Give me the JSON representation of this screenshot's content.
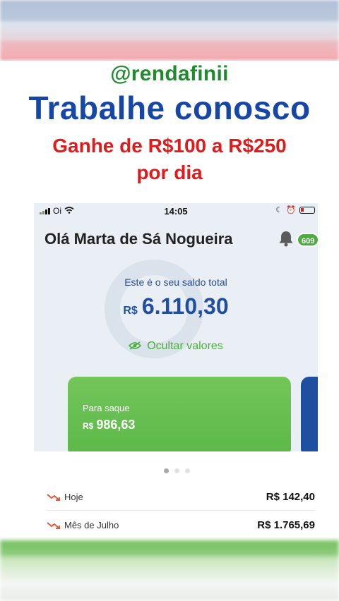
{
  "overlay": {
    "handle": "@rendafinii",
    "headline": "Trabalhe conosco",
    "subtitle_line1": "Ganhe de R$100 a R$250",
    "subtitle_line2": "por dia"
  },
  "status_bar": {
    "carrier": "Oi",
    "time": "14:05"
  },
  "app": {
    "greeting": "Olá Marta de Sá Nogueira",
    "notification_count": "609",
    "balance_label": "Este é o seu saldo total",
    "balance_currency": "R$",
    "balance_value": "6.110,30",
    "hide_values_label": "Ocultar valores",
    "withdraw_card": {
      "label": "Para saque",
      "currency": "R$",
      "value": "986,63"
    },
    "carousel": {
      "pages": 3,
      "active_index": 0
    },
    "earnings": [
      {
        "label": "Hoje",
        "value": "R$  142,40"
      },
      {
        "label": "Mês de Julho",
        "value": "R$  1.765,69"
      }
    ]
  },
  "colors": {
    "brand_blue": "#1f4fa0",
    "brand_green": "#4cae3e",
    "headline_red": "#e01b1b"
  }
}
